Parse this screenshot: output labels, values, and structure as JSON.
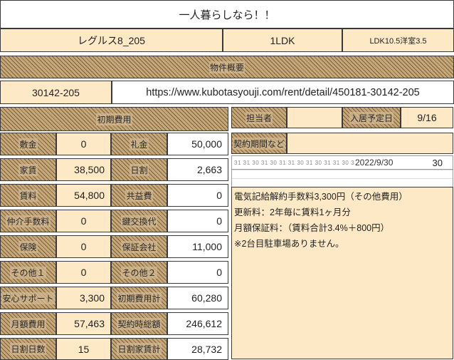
{
  "title": "一人暮らしなら！！",
  "property": {
    "name": "レグルス8_205",
    "layout": "1LDK",
    "room_detail": "LDK10.5洋室3.5"
  },
  "section_label_1": "物件概要",
  "property_id": "30142-205",
  "url": "https://www.kubotasyouji.com/rent/detail/450181-30142-205",
  "fees_header": "初期費用",
  "fees": [
    {
      "label_left": "敷金",
      "value_left": "0",
      "label_right": "礼金",
      "value_right": "50,000"
    },
    {
      "label_left": "家賃",
      "value_left": "38,500",
      "label_right": "日割",
      "value_right": "2,663"
    },
    {
      "label_left": "賃料",
      "value_left": "54,800",
      "label_right": "共益費",
      "value_right": "0"
    },
    {
      "label_left": "仲介手数料",
      "value_left": "0",
      "label_right": "鍵交換代",
      "value_right": "0"
    },
    {
      "label_left": "保険",
      "value_left": "0",
      "label_right": "保証会社",
      "value_right": "11,000"
    },
    {
      "label_left": "その他１",
      "value_left": "0",
      "label_right": "その他２",
      "value_right": "0"
    },
    {
      "label_left": "安心サポート",
      "value_left": "3,300",
      "label_right": "初期費用計",
      "value_right": "60,280"
    },
    {
      "label_left": "月額費用",
      "value_left": "57,463",
      "label_right": "契約時総額",
      "value_right": "246,612"
    },
    {
      "label_left": "日割日数",
      "value_left": "15",
      "label_right": "日割家賃計",
      "value_right": "28,732"
    }
  ],
  "contract": {
    "label_person": "担当者",
    "person_value": "",
    "label_date": "入居予定日",
    "date_value": "9/16",
    "label_note": "契約期間など",
    "note_value": ""
  },
  "calendar": {
    "ticks": "31 31 30 31 30 31 31 30 31 30 31 31 30 31 30",
    "date": "2022/9/30",
    "days": "30"
  },
  "notes": [
    "電気記給解約手数料3,300円（その他費用）",
    "更新料：2年毎に賃料1ヶ月分",
    "月額保証料：（賃料合計3.4%＋800円）",
    "※2台目駐車場ありません。"
  ]
}
